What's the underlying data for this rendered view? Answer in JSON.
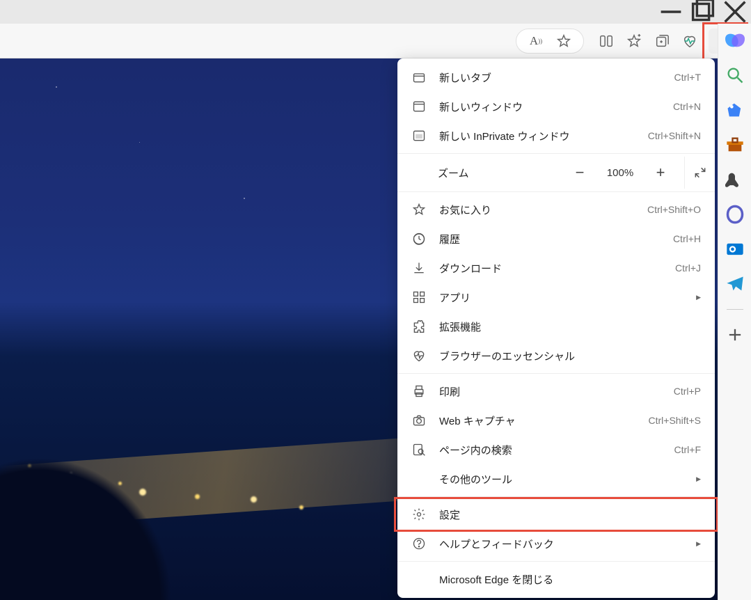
{
  "window": {
    "minimize": "—",
    "maximize": "❐",
    "close": "✕"
  },
  "toolbar": {
    "read_aloud": "A⁾",
    "star": "star",
    "split": "split",
    "favorites": "favorites",
    "collections": "collections",
    "health": "health",
    "more": "⋯"
  },
  "menu": {
    "new_tab": {
      "label": "新しいタブ",
      "shortcut": "Ctrl+T"
    },
    "new_window": {
      "label": "新しいウィンドウ",
      "shortcut": "Ctrl+N"
    },
    "new_inprivate": {
      "label": "新しい InPrivate ウィンドウ",
      "shortcut": "Ctrl+Shift+N"
    },
    "zoom": {
      "label": "ズーム",
      "value": "100%"
    },
    "favorites": {
      "label": "お気に入り",
      "shortcut": "Ctrl+Shift+O"
    },
    "history": {
      "label": "履歴",
      "shortcut": "Ctrl+H"
    },
    "downloads": {
      "label": "ダウンロード",
      "shortcut": "Ctrl+J"
    },
    "apps": {
      "label": "アプリ"
    },
    "extensions": {
      "label": "拡張機能"
    },
    "essentials": {
      "label": "ブラウザーのエッセンシャル"
    },
    "print": {
      "label": "印刷",
      "shortcut": "Ctrl+P"
    },
    "capture": {
      "label": "Web キャプチャ",
      "shortcut": "Ctrl+Shift+S"
    },
    "find": {
      "label": "ページ内の検索",
      "shortcut": "Ctrl+F"
    },
    "moretools": {
      "label": "その他のツール"
    },
    "settings": {
      "label": "設定"
    },
    "help": {
      "label": "ヘルプとフィードバック"
    },
    "close_edge": {
      "label": "Microsoft Edge を閉じる"
    }
  },
  "sidebar": {
    "search": "search",
    "shopping": "shopping",
    "briefcase": "briefcase",
    "games": "games",
    "office": "office",
    "outlook": "outlook",
    "send": "send",
    "add": "+"
  }
}
